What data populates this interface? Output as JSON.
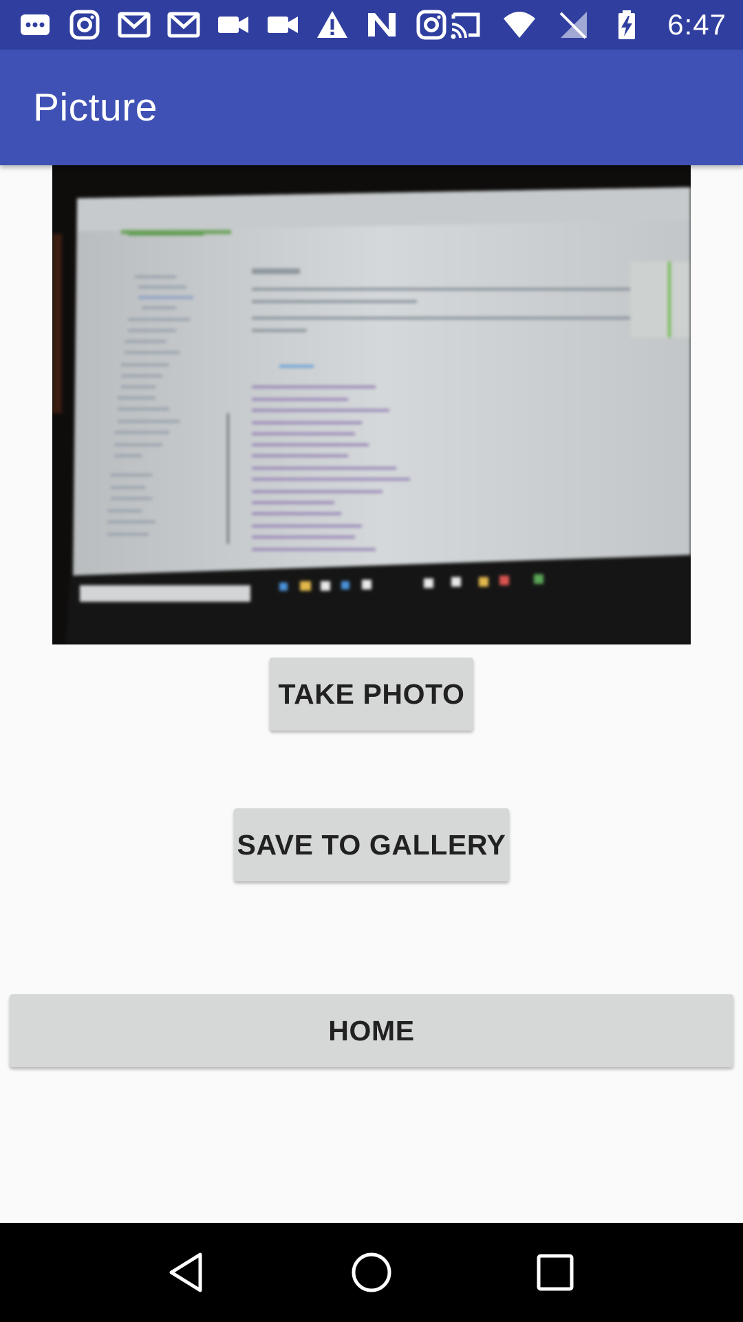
{
  "status_bar": {
    "time": "6:47",
    "left_icons": [
      "messages-icon",
      "instagram-icon",
      "gmail-icon",
      "gmail-icon",
      "video-camera-icon",
      "video-camera-icon",
      "warning-icon",
      "n-app-icon",
      "instagram-icon"
    ],
    "right_icons": [
      "cast-icon",
      "wifi-icon",
      "no-signal-icon",
      "battery-charging-icon"
    ],
    "background": "#303f9f"
  },
  "app_bar": {
    "title": "Picture",
    "background": "#3f51b5"
  },
  "photo": {
    "description_icon": "captured-photo"
  },
  "buttons": {
    "take_photo": "TAKE PHOTO",
    "save_to_gallery": "SAVE TO GALLERY",
    "home": "HOME"
  },
  "nav_bar": {
    "items": [
      "back-icon",
      "home-icon",
      "recents-icon"
    ]
  }
}
